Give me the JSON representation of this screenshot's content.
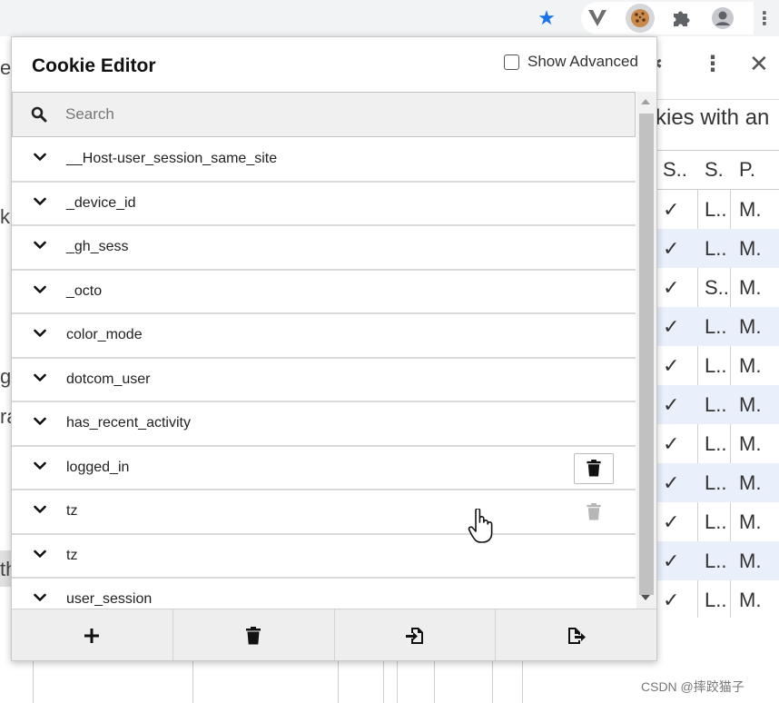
{
  "browser": {
    "icons": [
      "star-icon",
      "vimium-icon",
      "cookie-icon",
      "puzzle-icon",
      "profile-icon",
      "menu-dots-icon"
    ]
  },
  "devtools": {
    "filter_text": "kies with an",
    "columns": [
      "S..",
      "S.",
      "P."
    ],
    "rows": [
      [
        "✓",
        "L..",
        "M."
      ],
      [
        "✓",
        "L..",
        "M."
      ],
      [
        "✓",
        "S..",
        "M."
      ],
      [
        "✓",
        "L..",
        "M."
      ],
      [
        "✓",
        "L..",
        "M."
      ],
      [
        "✓",
        "L..",
        "M."
      ],
      [
        "✓",
        "L..",
        "M."
      ],
      [
        "✓",
        "L..",
        "M."
      ],
      [
        "✓",
        "L..",
        "M."
      ],
      [
        "✓",
        "L..",
        "M."
      ],
      [
        "✓",
        "L..",
        "M."
      ]
    ]
  },
  "page_fragments": [
    "e",
    "k",
    "g",
    "ra",
    "th"
  ],
  "cookie_editor": {
    "title": "Cookie Editor",
    "show_advanced_label": "Show Advanced",
    "show_advanced_checked": false,
    "search_placeholder": "Search",
    "cookies": [
      {
        "name": "__Host-user_session_same_site"
      },
      {
        "name": "_device_id"
      },
      {
        "name": "_gh_sess"
      },
      {
        "name": "_octo"
      },
      {
        "name": "color_mode"
      },
      {
        "name": "dotcom_user"
      },
      {
        "name": "has_recent_activity"
      },
      {
        "name": "logged_in",
        "delete_visible": true
      },
      {
        "name": "tz",
        "delete_faded": true
      },
      {
        "name": "tz"
      },
      {
        "name": "user_session"
      }
    ],
    "actions": [
      "add-icon",
      "delete-all-icon",
      "import-icon",
      "export-icon"
    ]
  },
  "watermark": "CSDN @摔跤猫子"
}
